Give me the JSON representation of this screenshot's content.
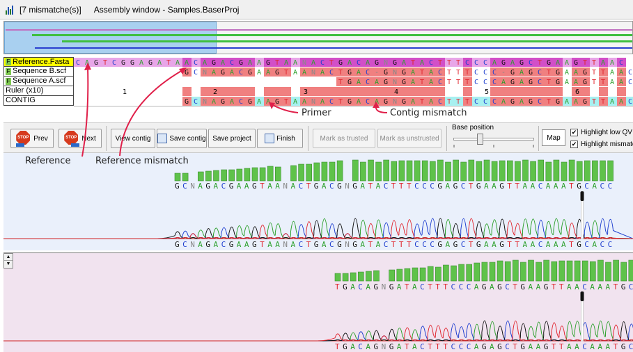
{
  "window": {
    "mismatch_count": "[7 mismatche(s)]",
    "title": "Assembly window - Samples.BaserProj"
  },
  "sequences": {
    "rows": [
      {
        "name": "Reference.Fasta",
        "badge": "F",
        "offset": 0,
        "bases": "CAGTCGGAGATAACAGACGAAGTAANACTGACAGNGATACTTTCCCAGAGCTGAAGTTAAC"
      },
      {
        "name": "Sequence B.scf",
        "badge": "F",
        "offset": 12,
        "bases": "GCNAGACGAAGTAANACTGAC-GNGATACTTTCCC-GAGCTGAAGTTAAC"
      },
      {
        "name": "Sequence A.scf",
        "badge": "F",
        "offset": 29,
        "bases": "TGACAGNGATACTTTCCCAGAGCTGAAGTTAAC"
      },
      {
        "name": "Ruler (x10)",
        "badge": "",
        "offset": 0,
        "bases": ""
      },
      {
        "name": "CONTIG",
        "badge": "",
        "offset": 12,
        "bases": "GCNAGACGAAGTAANACTGACAGNGATACTTTCCCAGAGCTGAAGTTAAC"
      }
    ],
    "ruler_labels": [
      "1",
      "2",
      "3",
      "4",
      "5",
      "6"
    ]
  },
  "toolbar": {
    "prev_label": "Prev",
    "next_label": "Next",
    "view_contig_label": "View contig",
    "save_contig_label": "Save contig",
    "save_project_label": "Save project",
    "finish_label": "Finish",
    "mark_trusted_label": "Mark as trusted",
    "mark_unstrusted_label": "Mark as unstrusted",
    "base_position_label": "Base position",
    "map_label": "Map",
    "highlight_low_qv_label": "Highlight low QV",
    "highlight_low_qv_checked": true,
    "highlight_mismatch_label": "Highlight mismatch",
    "highlight_mismatch_checked": true,
    "stop_icon_text": "STOP"
  },
  "traces": {
    "trace1_calls": "GCNAGACGAAGTAANACTGACGNGATACTTTCCCGAGCTGAAGTTAACAAATGCACC",
    "trace2_calls": "TGACAGNGATACTTTCCCAGAGCTGAAGTTAACAAATGCACC"
  },
  "annotations": {
    "reference": "Reference",
    "reference_mismatch": "Reference mismatch",
    "primer": "Primer",
    "contig_mismatch": "Contig mismatch"
  },
  "colors": {
    "A": "#2ca02c",
    "C": "#1f3fcf",
    "G": "#111111",
    "T": "#e0262f",
    "quality_bar": "#5fc24a",
    "reference_bg": "#e8a6e8",
    "contig_bg": "#a7f0f0",
    "mismatch_bg": "#f08080",
    "annotation_arrow": "#e0204a"
  }
}
